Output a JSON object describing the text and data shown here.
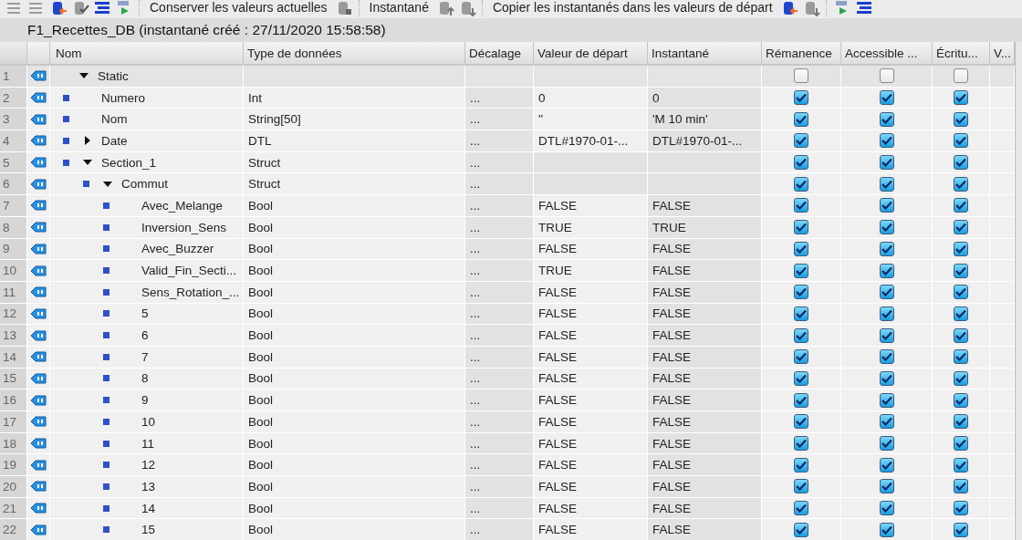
{
  "toolbar": {
    "items": [
      {
        "kind": "icon"
      },
      {
        "kind": "icon"
      },
      {
        "kind": "icon"
      },
      {
        "kind": "icon"
      },
      {
        "kind": "icon"
      },
      {
        "kind": "icon"
      },
      {
        "kind": "text",
        "label": "Conserver les valeurs actuelles"
      },
      {
        "kind": "icon"
      },
      {
        "kind": "text",
        "label": "Instantané"
      },
      {
        "kind": "icon"
      },
      {
        "kind": "icon"
      },
      {
        "kind": "text",
        "label": "Copier les instantanés dans les valeurs de départ"
      },
      {
        "kind": "icon"
      },
      {
        "kind": "icon"
      },
      {
        "kind": "icon"
      },
      {
        "kind": "icon"
      }
    ]
  },
  "title": "F1_Recettes_DB (instantané créé : 27/11/2020 15:58:58)",
  "table": {
    "columns": [
      "Nom",
      "Type de données",
      "Décalage",
      "Valeur de départ",
      "Instantané",
      "Rémanence",
      "Accessible ...",
      "Écritu...",
      "V..."
    ],
    "rows": [
      {
        "num": "1",
        "name": "Static",
        "retain": false,
        "accessible": false,
        "write": false,
        "expanded": true,
        "children": [
          {
            "num": "2",
            "name": "Numero",
            "type": "Int",
            "offset": "...",
            "start": "0",
            "snapshot": "0",
            "retain": true,
            "accessible": true,
            "write": true
          },
          {
            "num": "3",
            "name": "Nom",
            "type": "String[50]",
            "offset": "...",
            "start": "''",
            "snapshot": "'M 10 min'",
            "retain": true,
            "accessible": true,
            "write": true
          },
          {
            "num": "4",
            "name": "Date",
            "type": "DTL",
            "offset": "...",
            "start": "DTL#1970-01-...",
            "snapshot": "DTL#1970-01-...",
            "retain": true,
            "accessible": true,
            "write": true,
            "expanded": false
          },
          {
            "num": "5",
            "name": "Section_1",
            "type": "Struct",
            "offset": "...",
            "retain": true,
            "accessible": true,
            "write": true,
            "expanded": true,
            "children": [
              {
                "num": "6",
                "name": "Commut",
                "type": "Struct",
                "offset": "...",
                "retain": true,
                "accessible": true,
                "write": true,
                "expanded": true,
                "children": [
                  {
                    "num": "7",
                    "name": "Avec_Melange",
                    "type": "Bool",
                    "offset": "...",
                    "start": "FALSE",
                    "snapshot": "FALSE",
                    "retain": true,
                    "accessible": true,
                    "write": true
                  },
                  {
                    "num": "8",
                    "name": "Inversion_Sens",
                    "type": "Bool",
                    "offset": "...",
                    "start": "TRUE",
                    "snapshot": "TRUE",
                    "retain": true,
                    "accessible": true,
                    "write": true
                  },
                  {
                    "num": "9",
                    "name": "Avec_Buzzer",
                    "type": "Bool",
                    "offset": "...",
                    "start": "FALSE",
                    "snapshot": "FALSE",
                    "retain": true,
                    "accessible": true,
                    "write": true
                  },
                  {
                    "num": "10",
                    "name": "Valid_Fin_Secti...",
                    "type": "Bool",
                    "offset": "...",
                    "start": "TRUE",
                    "snapshot": "FALSE",
                    "retain": true,
                    "accessible": true,
                    "write": true
                  },
                  {
                    "num": "11",
                    "name": "Sens_Rotation_...",
                    "type": "Bool",
                    "offset": "...",
                    "start": "FALSE",
                    "snapshot": "FALSE",
                    "retain": true,
                    "accessible": true,
                    "write": true
                  },
                  {
                    "num": "12",
                    "name": "5",
                    "type": "Bool",
                    "offset": "...",
                    "start": "FALSE",
                    "snapshot": "FALSE",
                    "retain": true,
                    "accessible": true,
                    "write": true
                  },
                  {
                    "num": "13",
                    "name": "6",
                    "type": "Bool",
                    "offset": "...",
                    "start": "FALSE",
                    "snapshot": "FALSE",
                    "retain": true,
                    "accessible": true,
                    "write": true
                  },
                  {
                    "num": "14",
                    "name": "7",
                    "type": "Bool",
                    "offset": "...",
                    "start": "FALSE",
                    "snapshot": "FALSE",
                    "retain": true,
                    "accessible": true,
                    "write": true
                  },
                  {
                    "num": "15",
                    "name": "8",
                    "type": "Bool",
                    "offset": "...",
                    "start": "FALSE",
                    "snapshot": "FALSE",
                    "retain": true,
                    "accessible": true,
                    "write": true
                  },
                  {
                    "num": "16",
                    "name": "9",
                    "type": "Bool",
                    "offset": "...",
                    "start": "FALSE",
                    "snapshot": "FALSE",
                    "retain": true,
                    "accessible": true,
                    "write": true
                  },
                  {
                    "num": "17",
                    "name": "10",
                    "type": "Bool",
                    "offset": "...",
                    "start": "FALSE",
                    "snapshot": "FALSE",
                    "retain": true,
                    "accessible": true,
                    "write": true
                  },
                  {
                    "num": "18",
                    "name": "11",
                    "type": "Bool",
                    "offset": "...",
                    "start": "FALSE",
                    "snapshot": "FALSE",
                    "retain": true,
                    "accessible": true,
                    "write": true
                  },
                  {
                    "num": "19",
                    "name": "12",
                    "type": "Bool",
                    "offset": "...",
                    "start": "FALSE",
                    "snapshot": "FALSE",
                    "retain": true,
                    "accessible": true,
                    "write": true
                  },
                  {
                    "num": "20",
                    "name": "13",
                    "type": "Bool",
                    "offset": "...",
                    "start": "FALSE",
                    "snapshot": "FALSE",
                    "retain": true,
                    "accessible": true,
                    "write": true
                  },
                  {
                    "num": "21",
                    "name": "14",
                    "type": "Bool",
                    "offset": "...",
                    "start": "FALSE",
                    "snapshot": "FALSE",
                    "retain": true,
                    "accessible": true,
                    "write": true
                  },
                  {
                    "num": "22",
                    "name": "15",
                    "type": "Bool",
                    "offset": "...",
                    "start": "FALSE",
                    "snapshot": "FALSE",
                    "retain": true,
                    "accessible": true,
                    "write": true
                  }
                ]
              }
            ]
          }
        ]
      }
    ]
  }
}
